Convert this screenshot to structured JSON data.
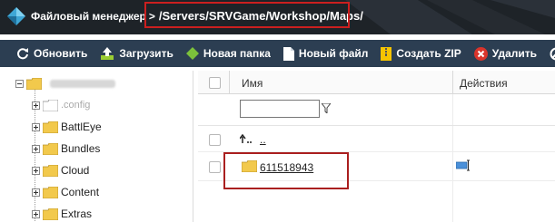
{
  "header": {
    "app_title": "Файловый менеджер",
    "separator": ">",
    "path": "/Servers/SRVGame/Workshop/Maps/"
  },
  "toolbar": {
    "buttons": [
      {
        "label": "Обновить",
        "icon": "refresh-icon"
      },
      {
        "label": "Загрузить",
        "icon": "upload-icon"
      },
      {
        "label": "Новая папка",
        "icon": "new-folder-icon"
      },
      {
        "label": "Новый файл",
        "icon": "new-file-icon"
      },
      {
        "label": "Создать ZIP",
        "icon": "zip-icon"
      },
      {
        "label": "Удалить",
        "icon": "delete-icon"
      }
    ]
  },
  "tree": {
    "root_label_hidden": true,
    "items": [
      {
        "label": ".config",
        "muted": true
      },
      {
        "label": "BattlEye"
      },
      {
        "label": "Bundles"
      },
      {
        "label": "Cloud"
      },
      {
        "label": "Content"
      },
      {
        "label": "Extras"
      }
    ]
  },
  "list": {
    "columns": {
      "name": "Имя",
      "actions": "Действия"
    },
    "filter": {
      "value": "",
      "icon": "filter-icon"
    },
    "parent_link": "..",
    "rows": [
      {
        "name": "611518943",
        "type": "folder",
        "action_icon": "rename-icon"
      }
    ]
  },
  "colors": {
    "header_bg": "#1e2328",
    "toolbar_bg": "#2c3e52",
    "highlight": "#cc1f1f",
    "folder": "#f2c94c"
  }
}
